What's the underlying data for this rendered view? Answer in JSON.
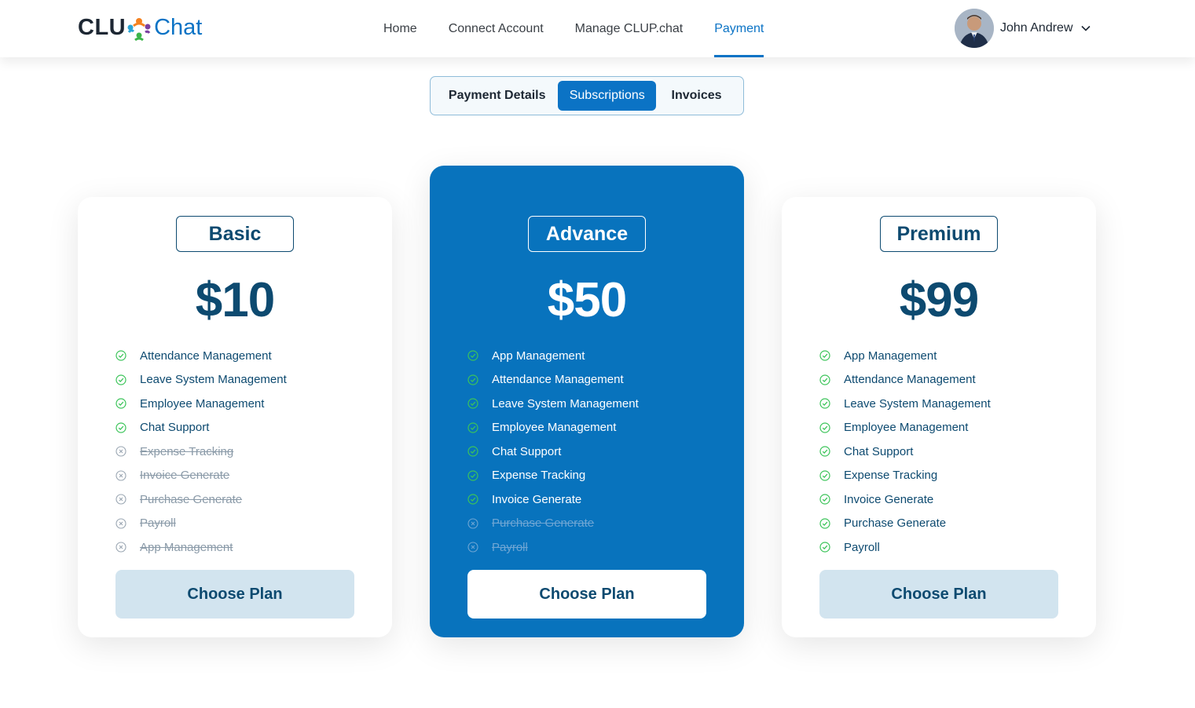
{
  "brand": {
    "logo_part1": "CLU",
    "logo_part2": "Chat",
    "brand_blue": "#0b73c5",
    "dark_navy": "#0d4a70"
  },
  "nav": {
    "items": [
      {
        "label": "Home",
        "active": false
      },
      {
        "label": "Connect Account",
        "active": false
      },
      {
        "label": "Manage CLUP.chat",
        "active": false
      },
      {
        "label": "Payment",
        "active": true
      }
    ]
  },
  "user": {
    "name": "John Andrew",
    "avatar_icon": "avatar-photo",
    "dropdown_icon": "chevron-down-icon"
  },
  "tabs": [
    {
      "label": "Payment Details",
      "active": false
    },
    {
      "label": "Subscriptions",
      "active": true
    },
    {
      "label": "Invoices",
      "active": false
    }
  ],
  "plans": [
    {
      "name": "Basic",
      "price": "$10",
      "features": [
        {
          "label": "Attendance Management",
          "included": true
        },
        {
          "label": "Leave System Management",
          "included": true
        },
        {
          "label": "Employee Management",
          "included": true
        },
        {
          "label": "Chat Support",
          "included": true
        },
        {
          "label": "Expense Tracking",
          "included": false
        },
        {
          "label": "Invoice Generate",
          "included": false
        },
        {
          "label": "Purchase Generate",
          "included": false
        },
        {
          "label": "Payroll",
          "included": false
        },
        {
          "label": "App Management",
          "included": false
        }
      ],
      "button_label": "Choose Plan"
    },
    {
      "name": "Advance",
      "price": "$50",
      "highlighted": true,
      "features": [
        {
          "label": "App Management",
          "included": true
        },
        {
          "label": "Attendance Management",
          "included": true
        },
        {
          "label": "Leave System Management",
          "included": true
        },
        {
          "label": "Employee Management",
          "included": true
        },
        {
          "label": "Chat Support",
          "included": true
        },
        {
          "label": "Expense Tracking",
          "included": true
        },
        {
          "label": "Invoice Generate",
          "included": true
        },
        {
          "label": "Purchase Generate",
          "included": false
        },
        {
          "label": "Payroll",
          "included": false
        }
      ],
      "button_label": "Choose Plan"
    },
    {
      "name": "Premium",
      "price": "$99",
      "features": [
        {
          "label": "App Management",
          "included": true
        },
        {
          "label": "Attendance Management",
          "included": true
        },
        {
          "label": "Leave System Management",
          "included": true
        },
        {
          "label": "Employee Management",
          "included": true
        },
        {
          "label": "Chat Support",
          "included": true
        },
        {
          "label": "Expense Tracking",
          "included": true
        },
        {
          "label": "Invoice Generate",
          "included": true
        },
        {
          "label": "Purchase Generate",
          "included": true
        },
        {
          "label": "Payroll",
          "included": true
        }
      ],
      "button_label": "Choose Plan"
    }
  ]
}
